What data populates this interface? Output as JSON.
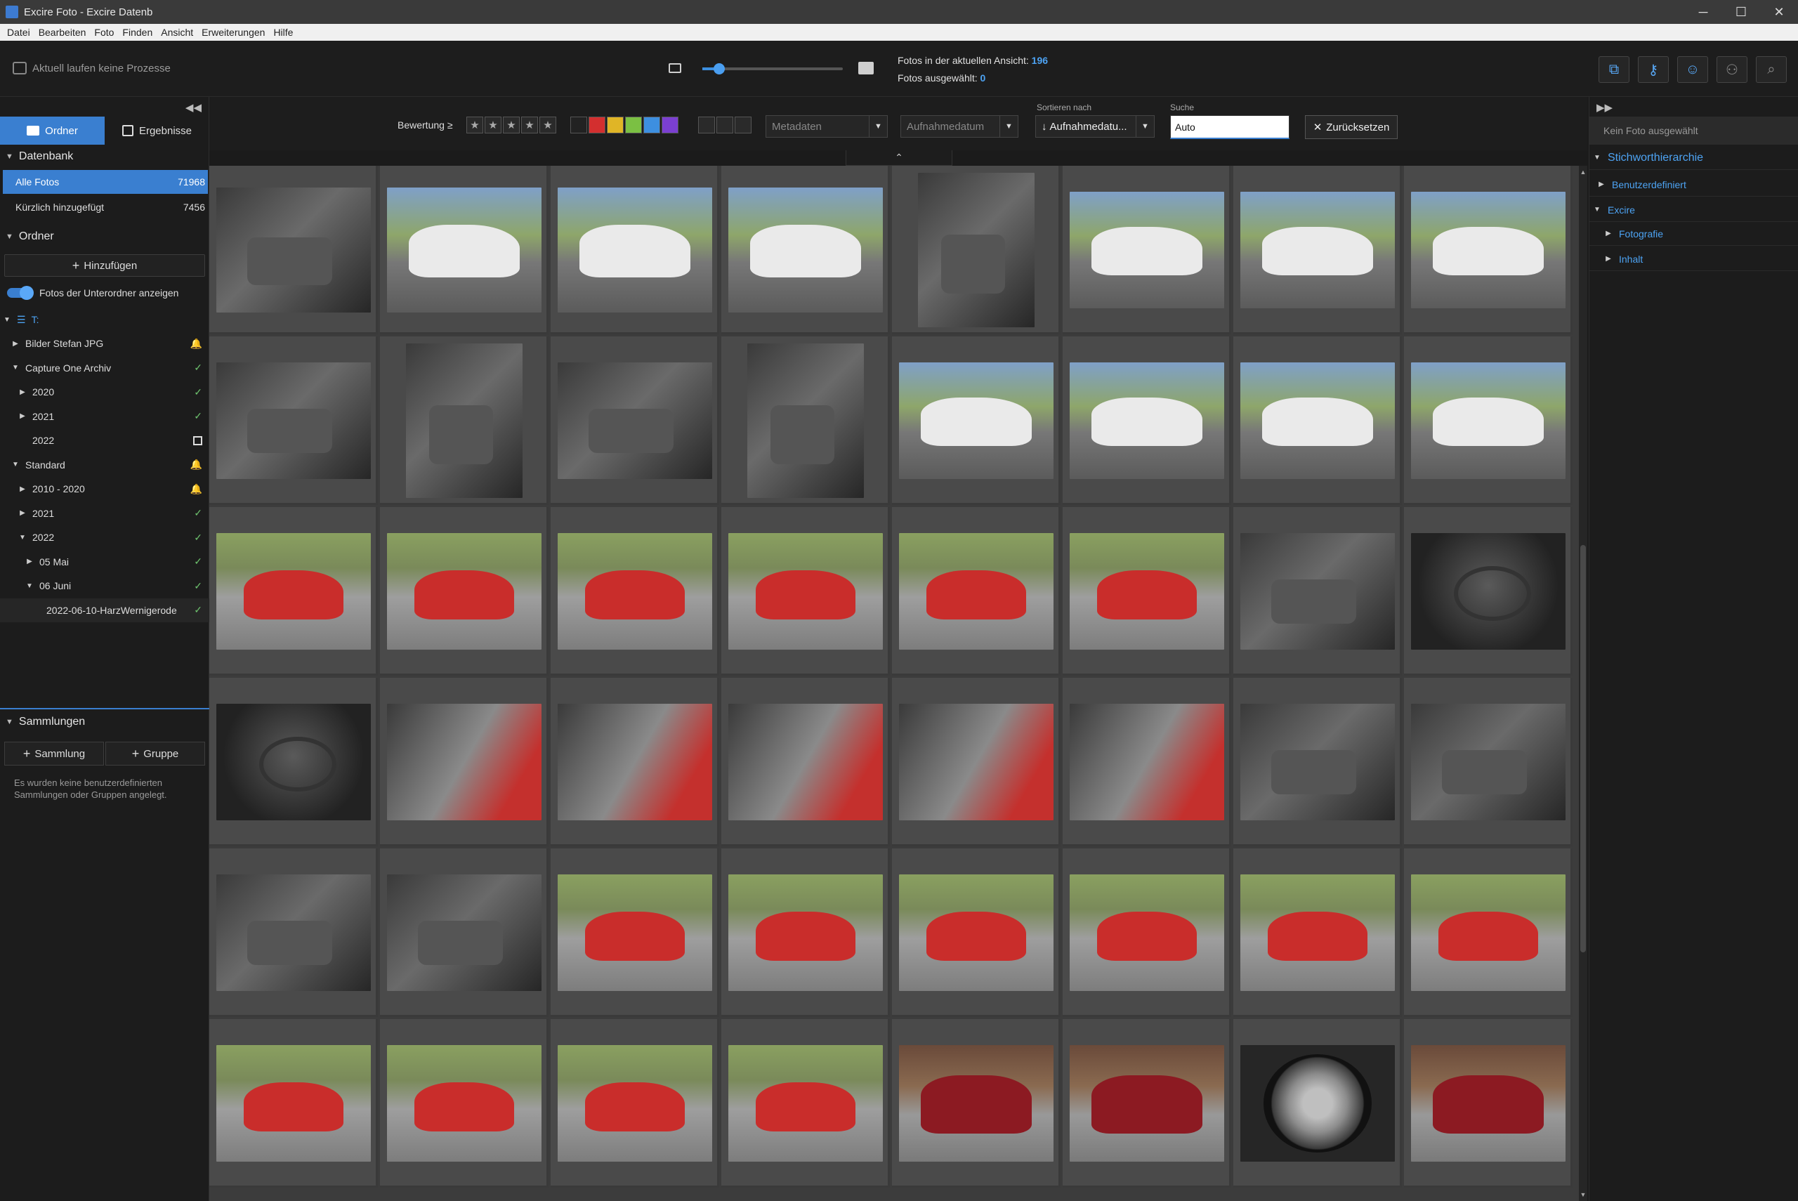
{
  "window": {
    "title": "Excire Foto - Excire Datenb"
  },
  "menu": [
    "Datei",
    "Bearbeiten",
    "Foto",
    "Finden",
    "Ansicht",
    "Erweiterungen",
    "Hilfe"
  ],
  "toolbar": {
    "process_status": "Aktuell laufen keine Prozesse",
    "zoom_level": 0.12,
    "stats": {
      "in_view_label": "Fotos in der aktuellen Ansicht:",
      "in_view": "196",
      "selected_label": "Fotos ausgewählt:",
      "selected": "0"
    }
  },
  "left": {
    "tabs": {
      "folder": "Ordner",
      "results": "Ergebnisse"
    },
    "database": {
      "header": "Datenbank",
      "all": {
        "label": "Alle Fotos",
        "count": "71968"
      },
      "recent": {
        "label": "Kürzlich hinzugefügt",
        "count": "7456"
      }
    },
    "folders": {
      "header": "Ordner",
      "add": "Hinzufügen",
      "subfolders_toggle": "Fotos der Unterordner anzeigen",
      "drive": "T:"
    },
    "tree": [
      {
        "label": "Bilder Stefan JPG",
        "arrow": "▶",
        "level": 1,
        "status": "bell"
      },
      {
        "label": "Capture One Archiv",
        "arrow": "▼",
        "level": 1,
        "status": "ok"
      },
      {
        "label": "2020",
        "arrow": "▶",
        "level": 2,
        "status": "ok"
      },
      {
        "label": "2021",
        "arrow": "▶",
        "level": 2,
        "status": "ok"
      },
      {
        "label": "2022",
        "arrow": "",
        "level": 2,
        "status": "box"
      },
      {
        "label": "Standard",
        "arrow": "▼",
        "level": 1,
        "status": "bell"
      },
      {
        "label": "2010 - 2020",
        "arrow": "▶",
        "level": 2,
        "status": "bell"
      },
      {
        "label": "2021",
        "arrow": "▶",
        "level": 2,
        "status": "ok"
      },
      {
        "label": "2022",
        "arrow": "▼",
        "level": 2,
        "status": "ok"
      },
      {
        "label": "05 Mai",
        "arrow": "▶",
        "level": 3,
        "status": "ok"
      },
      {
        "label": "06 Juni",
        "arrow": "▼",
        "level": 3,
        "status": "ok"
      },
      {
        "label": "2022-06-10-HarzWernigerode",
        "arrow": "",
        "level": 4,
        "status": "ok"
      }
    ],
    "collections": {
      "header": "Sammlungen",
      "add_collection": "Sammlung",
      "add_group": "Gruppe",
      "empty": "Es wurden keine benutzerdefinierten Sammlungen oder Gruppen angelegt."
    }
  },
  "filter": {
    "rating_label": "Bewertung ≥",
    "colors": [
      "#222222",
      "#d32f2f",
      "#e0b526",
      "#7bc043",
      "#3d8fe0",
      "#7b3fd1"
    ],
    "metadata": "Metadaten",
    "date": "Aufnahmedatum",
    "sort_label": "Sortieren nach",
    "sort": "Aufnahmedatu...",
    "search_label": "Suche",
    "search_value": "Auto",
    "reset": "Zurücksetzen"
  },
  "photos": [
    [
      [
        "interior",
        0.92,
        0.74
      ],
      [
        "white",
        0.92,
        0.74
      ],
      [
        "white",
        0.92,
        0.74
      ],
      [
        "white",
        0.92,
        0.74
      ],
      [
        "interior",
        0.69,
        0.92
      ],
      [
        "white",
        0.92,
        0.69
      ],
      [
        "white",
        0.92,
        0.69
      ],
      [
        "white",
        0.92,
        0.69
      ]
    ],
    [
      [
        "interior",
        0.92,
        0.69
      ],
      [
        "interior",
        0.69,
        0.92
      ],
      [
        "interior",
        0.92,
        0.69
      ],
      [
        "interior",
        0.69,
        0.92
      ],
      [
        "white",
        0.92,
        0.69
      ],
      [
        "white",
        0.92,
        0.69
      ],
      [
        "white",
        0.92,
        0.69
      ],
      [
        "white",
        0.92,
        0.69
      ]
    ],
    [
      [
        "red",
        0.92,
        0.69
      ],
      [
        "red",
        0.92,
        0.69
      ],
      [
        "red",
        0.92,
        0.69
      ],
      [
        "red",
        0.92,
        0.69
      ],
      [
        "red",
        0.92,
        0.69
      ],
      [
        "red",
        0.92,
        0.69
      ],
      [
        "interior",
        0.92,
        0.69
      ],
      [
        "dash",
        0.92,
        0.69
      ]
    ],
    [
      [
        "dash",
        0.92,
        0.69
      ],
      [
        "redint",
        0.92,
        0.69
      ],
      [
        "redint",
        0.92,
        0.69
      ],
      [
        "redint",
        0.92,
        0.69
      ],
      [
        "redint",
        0.92,
        0.69
      ],
      [
        "redint",
        0.92,
        0.69
      ],
      [
        "interior",
        0.92,
        0.69
      ],
      [
        "interior",
        0.92,
        0.69
      ]
    ],
    [
      [
        "interior",
        0.92,
        0.69
      ],
      [
        "interior",
        0.92,
        0.69
      ],
      [
        "red",
        0.92,
        0.69
      ],
      [
        "red",
        0.92,
        0.69
      ],
      [
        "red",
        0.92,
        0.69
      ],
      [
        "red",
        0.92,
        0.69
      ],
      [
        "red",
        0.92,
        0.69
      ],
      [
        "red",
        0.92,
        0.69
      ]
    ],
    [
      [
        "red",
        0.92,
        0.69
      ],
      [
        "red",
        0.92,
        0.69
      ],
      [
        "red",
        0.92,
        0.69
      ],
      [
        "red",
        0.92,
        0.69
      ],
      [
        "maroon",
        0.92,
        0.69
      ],
      [
        "maroon",
        0.92,
        0.69
      ],
      [
        "wheel",
        0.92,
        0.69
      ],
      [
        "maroon",
        0.92,
        0.69
      ]
    ]
  ]
}
